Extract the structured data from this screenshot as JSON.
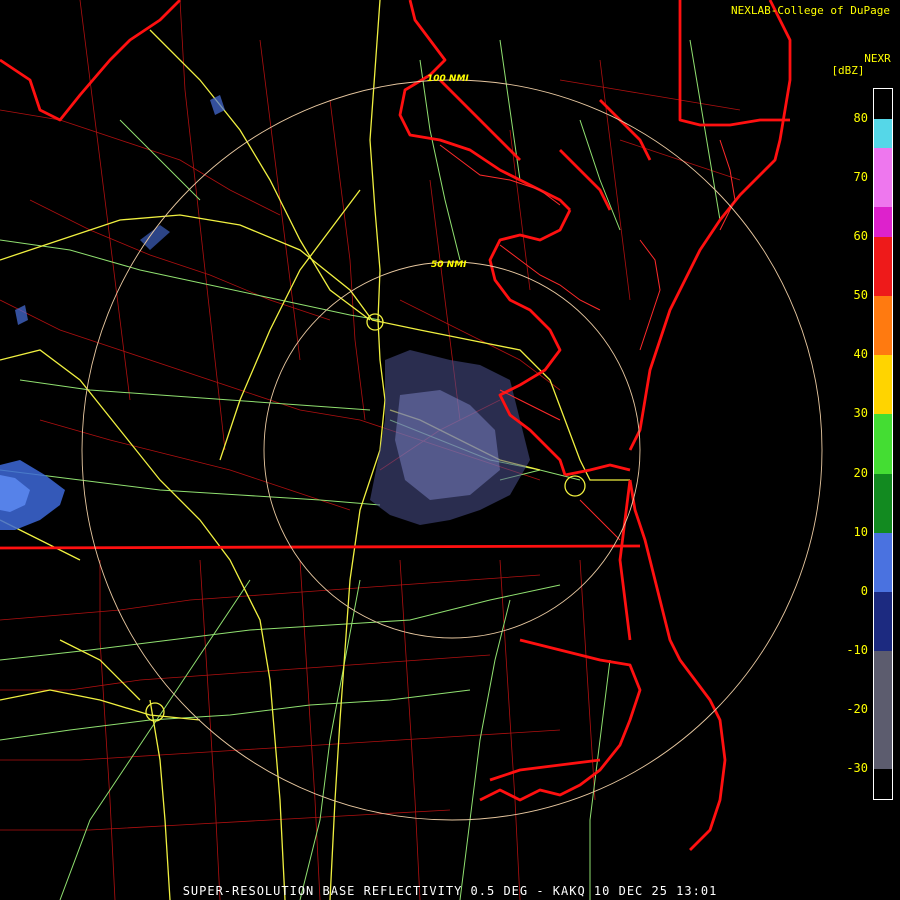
{
  "header": {
    "credit": "NEXLAB-College of DuPage",
    "product": "NEXR",
    "unit": "[dBZ]"
  },
  "footer": {
    "caption": "SUPER-RESOLUTION BASE REFLECTIVITY 0.5 DEG - KAKQ 10 DEC 25 13:01"
  },
  "range_rings": [
    {
      "label": "100 NMI",
      "nmi": 100
    },
    {
      "label": "50 NMI",
      "nmi": 50
    }
  ],
  "colorbar": {
    "ticks": [
      80,
      70,
      60,
      50,
      40,
      30,
      20,
      10,
      0,
      -10,
      -20,
      -30
    ],
    "min": -35,
    "max": 85,
    "segments": [
      {
        "from": 75,
        "to": 80,
        "color": "#55d7e8"
      },
      {
        "from": 65,
        "to": 75,
        "color": "#ee77ee"
      },
      {
        "from": 60,
        "to": 65,
        "color": "#dd22cc"
      },
      {
        "from": 50,
        "to": 60,
        "color": "#ee1a1a"
      },
      {
        "from": 40,
        "to": 50,
        "color": "#ff7a10"
      },
      {
        "from": 30,
        "to": 40,
        "color": "#ffd400"
      },
      {
        "from": 20,
        "to": 30,
        "color": "#44dd33"
      },
      {
        "from": 10,
        "to": 20,
        "color": "#128a20"
      },
      {
        "from": 0,
        "to": 10,
        "color": "#4a72e0"
      },
      {
        "from": -10,
        "to": 0,
        "color": "#1c2a80"
      },
      {
        "from": -30,
        "to": -10,
        "color": "#5c5c6e"
      }
    ]
  },
  "colors": {
    "state_border": "#ff1010",
    "county_border": "#cc1010",
    "highway_major": "#f0f040",
    "highway_minor": "#90e070",
    "range_ring": "#e8c8a0",
    "echo": "#8088c8"
  }
}
